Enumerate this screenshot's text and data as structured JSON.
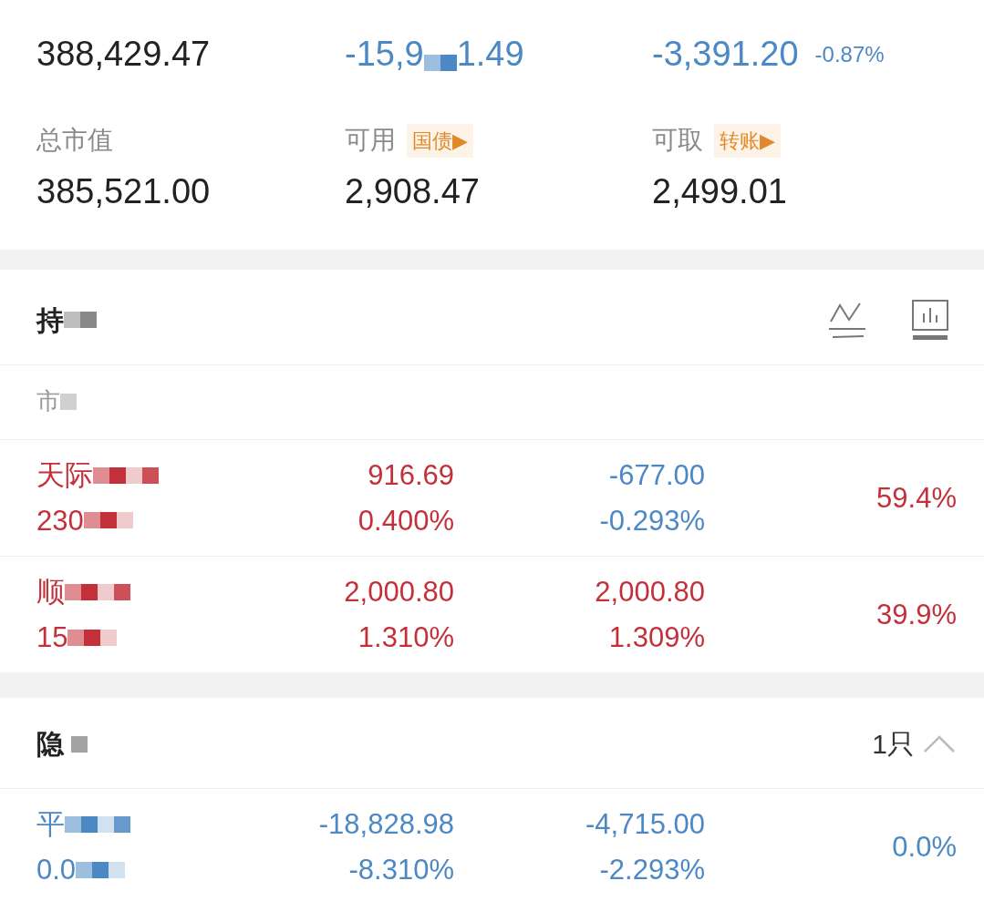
{
  "summary_top": [
    {
      "parts": [
        "388,429.47"
      ],
      "color": "#222222"
    },
    {
      "parts": [
        "-15,9",
        "1.49"
      ],
      "color": "#4b88c4"
    },
    {
      "parts": [
        "-3,391.20"
      ],
      "color": "#4b88c4",
      "change": "-0.87%"
    }
  ],
  "summary_bottom": [
    {
      "label": "总市值",
      "value": "385,521.00"
    },
    {
      "label": "可用",
      "tag": "国债▶",
      "value": "2,908.47"
    },
    {
      "label": "可取",
      "tag": "转账▶",
      "value": "2,499.01"
    }
  ],
  "holdings": {
    "title": "持",
    "column_1": "市",
    "rows": [
      {
        "name": "天际",
        "code": "230",
        "color": "#c4303a",
        "column_2": {
          "values": [
            "916.69",
            "0.400%"
          ],
          "color": "#c4303a"
        },
        "column_3": {
          "values": [
            "-677.00",
            "-0.293%"
          ],
          "color": "#4b88c4"
        },
        "share": "59.4%"
      },
      {
        "name": "顺",
        "code": "15",
        "color": "#c4303a",
        "column_2": {
          "values": [
            "2,000.80",
            "1.310%"
          ],
          "color": "#c4303a"
        },
        "column_3": {
          "values": [
            "2,000.80",
            "1.309%"
          ],
          "color": "#c4303a"
        },
        "share": "39.9%"
      }
    ]
  },
  "hidden": {
    "title": "隐",
    "count": "1只",
    "expanded": true,
    "rows": [
      {
        "name": "平",
        "code": "0.0",
        "color": "#4b88c4",
        "column_2": {
          "values": [
            "-18,828.98",
            "-8.310%"
          ],
          "color": "#4b88c4"
        },
        "column_3": {
          "values": [
            "-4,715.00",
            "-2.293%"
          ],
          "color": "#4b88c4"
        },
        "share": "0.0%"
      }
    ]
  }
}
